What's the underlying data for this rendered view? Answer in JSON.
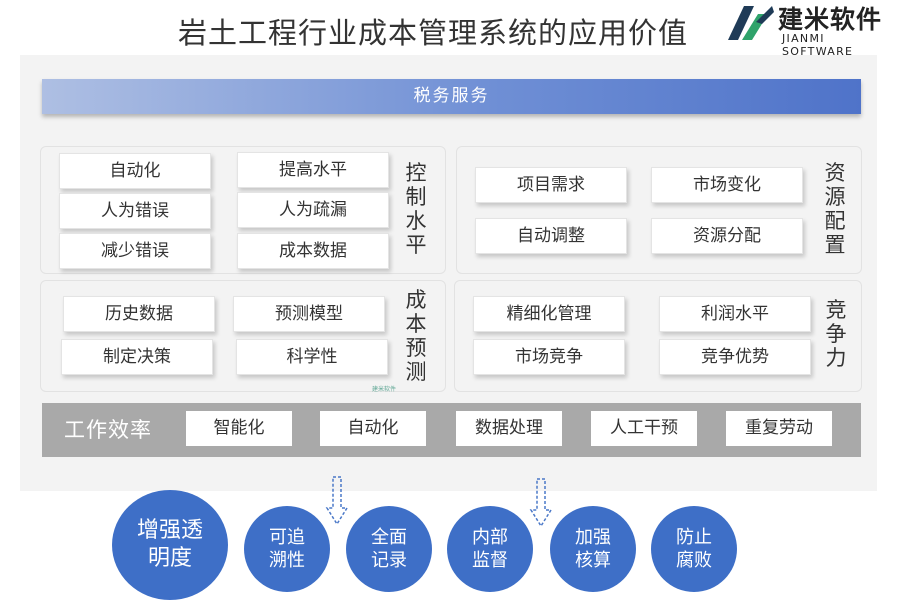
{
  "header": {
    "title": "岩土工程行业成本管理系统的应用价值"
  },
  "logo": {
    "name_cn": "建米软件",
    "name_en": "JIANMI SOFTWARE",
    "icon": "jianmi-logo-icon"
  },
  "tax_bar": {
    "label": "税务服务"
  },
  "groups": {
    "control": {
      "label": "控制水平",
      "chips": [
        "自动化",
        "提高水平",
        "人为错误",
        "人为疏漏",
        "减少错误",
        "成本数据"
      ]
    },
    "resource": {
      "label": "资源配置",
      "chips": [
        "项目需求",
        "市场变化",
        "自动调整",
        "资源分配"
      ]
    },
    "forecast": {
      "label": "成本预测",
      "chips": [
        "历史数据",
        "预测模型",
        "制定决策",
        "科学性"
      ]
    },
    "compete": {
      "label": "竞争力",
      "chips": [
        "精细化管理",
        "利润水平",
        "市场竞争",
        "竞争优势"
      ]
    }
  },
  "watermark": {
    "text": "建米软件"
  },
  "efficiency": {
    "label": "工作效率",
    "chips": [
      "智能化",
      "自动化",
      "数据处理",
      "人工干预",
      "重复劳动"
    ]
  },
  "circles": {
    "main": [
      "增强透",
      "明度"
    ],
    "items": [
      [
        "可追",
        "溯性"
      ],
      [
        "全面",
        "记录"
      ],
      [
        "内部",
        "监督"
      ],
      [
        "加强",
        "核算"
      ],
      [
        "防止",
        "腐败"
      ]
    ]
  },
  "colors": {
    "accent": "#3e6fc7",
    "bar_gray": "#a9a9a9",
    "panel_bg": "#f3f3f3"
  }
}
